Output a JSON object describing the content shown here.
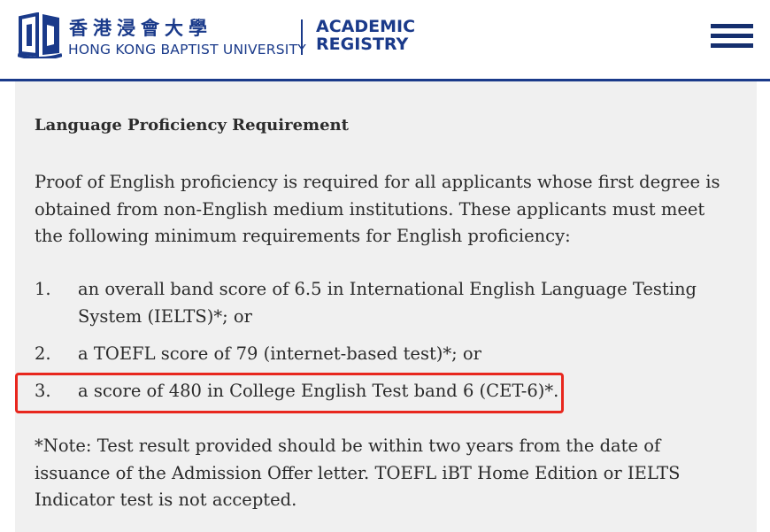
{
  "header": {
    "university_zh": "香港浸會大學",
    "university_en": "HONG KONG BAPTIST UNIVERSITY",
    "dept_line1": "ACADEMIC",
    "dept_line2": "REGISTRY",
    "menu_icon": "hamburger-menu-icon",
    "brand_color": "#1a3a8a"
  },
  "content": {
    "heading": "Language Proficiency Requirement",
    "intro": "Proof of English proficiency is required for all applicants whose first degree is obtained from non-English medium institutions. These applicants must meet the following minimum requirements for English proficiency:",
    "items": [
      {
        "num": "1.",
        "text": "an overall band score of 6.5 in International English Language Testing System (IELTS)*; or"
      },
      {
        "num": "2.",
        "text": "a TOEFL score of 79 (internet-based test)*; or"
      },
      {
        "num": "3.",
        "text": "a score of 480 in College English Test band 6 (CET-6)*."
      }
    ],
    "highlight_color": "#e8271e",
    "note": " *Note: Test result provided should be within two years from the date of issuance of the Admission Offer letter. TOEFL iBT Home Edition or IELTS Indicator test is not accepted."
  }
}
